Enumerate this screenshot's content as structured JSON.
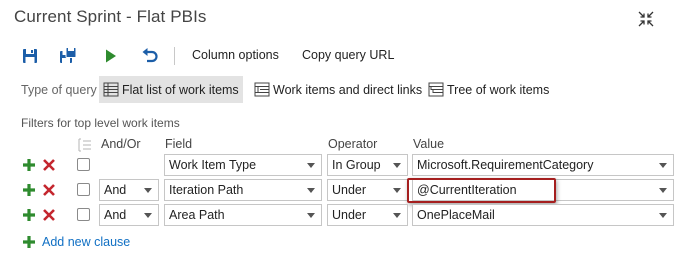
{
  "window": {
    "title": "Current Sprint - Flat PBIs"
  },
  "toolbar": {
    "items": [
      {
        "name": "save-query",
        "icon": "save-icon"
      },
      {
        "name": "save-as",
        "icon": "save-as-icon"
      },
      {
        "name": "run-query",
        "icon": "play-icon"
      },
      {
        "name": "revert-changes",
        "icon": "undo-icon"
      }
    ],
    "column_options_label": "Column options",
    "copy_query_url_label": "Copy query URL"
  },
  "query_type": {
    "label": "Type of query",
    "options": [
      {
        "label": "Flat list of work items",
        "icon": "flat-list-icon",
        "selected": true
      },
      {
        "label": "Work items and direct links",
        "icon": "direct-links-icon",
        "selected": false
      },
      {
        "label": "Tree of work items",
        "icon": "tree-icon",
        "selected": false
      }
    ]
  },
  "filters": {
    "heading": "Filters for top level work items",
    "columns": {
      "and_or": "And/Or",
      "field": "Field",
      "operator": "Operator",
      "value": "Value"
    },
    "clauses": [
      {
        "and_or": "",
        "field": "Work Item Type",
        "operator": "In Group",
        "value": "Microsoft.RequirementCategory",
        "checked": false
      },
      {
        "and_or": "And",
        "field": "Iteration Path",
        "operator": "Under",
        "value": "@CurrentIteration",
        "checked": false,
        "highlighted": true
      },
      {
        "and_or": "And",
        "field": "Area Path",
        "operator": "Under",
        "value": "OnePlaceMail",
        "checked": false
      }
    ],
    "add_clause_label": "Add new clause"
  },
  "colors": {
    "accent_green": "#2e8b2e",
    "delete_red": "#c4262e",
    "link_blue": "#1170c4",
    "toolbar_blue": "#1c5ea8",
    "highlight_border": "#a51f1f",
    "selected_bg": "#e3e3e3"
  }
}
